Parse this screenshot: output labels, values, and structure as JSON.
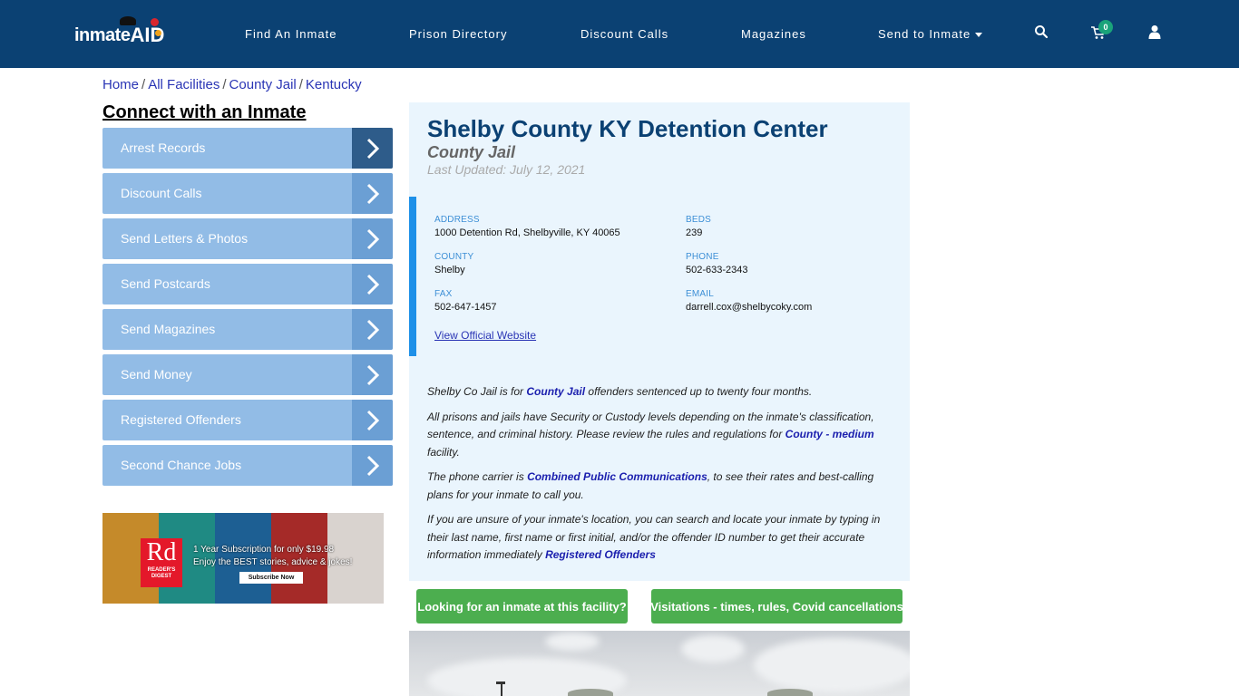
{
  "navbar": {
    "logo": {
      "prefix": "inmate",
      "suffix": "AID"
    },
    "items": [
      {
        "label": "Find An Inmate"
      },
      {
        "label": "Prison Directory"
      },
      {
        "label": "Discount Calls"
      },
      {
        "label": "Magazines"
      },
      {
        "label": "Send to Inmate",
        "has_dropdown": true
      }
    ],
    "icons": [
      "search-icon",
      "cart-icon",
      "user-icon"
    ],
    "cart_count": "0",
    "colors": {
      "background": "#0b4173",
      "badge": "#1aa37a"
    }
  },
  "breadcrumb": {
    "items": [
      "Home",
      "All Facilities",
      "County Jail",
      "Kentucky"
    ],
    "separator": "/"
  },
  "sidebar": {
    "title": "Connect with an Inmate",
    "items": [
      {
        "label": "Arrest Records",
        "active": true
      },
      {
        "label": "Discount Calls"
      },
      {
        "label": "Send Letters & Photos"
      },
      {
        "label": "Send Postcards"
      },
      {
        "label": "Send Magazines"
      },
      {
        "label": "Send Money"
      },
      {
        "label": "Registered Offenders"
      },
      {
        "label": "Second Chance Jobs"
      }
    ],
    "ad": {
      "logo_big": "Rd",
      "logo_small_1": "READER'S",
      "logo_small_2": "DIGEST",
      "line1": "1 Year Subscription for only $19.98",
      "line2": "Enjoy the BEST stories, advice & jokes!",
      "button": "Subscribe Now"
    }
  },
  "facility": {
    "name": "Shelby County KY Detention Center",
    "type": "County Jail",
    "last_updated": "Last Updated: July 12, 2021",
    "fields": {
      "address": {
        "label": "ADDRESS",
        "value": "1000 Detention Rd, Shelbyville, KY 40065"
      },
      "beds": {
        "label": "BEDS",
        "value": "239"
      },
      "county": {
        "label": "COUNTY",
        "value": "Shelby"
      },
      "phone": {
        "label": "PHONE",
        "value": "502-633-2343"
      },
      "fax": {
        "label": "FAX",
        "value": "502-647-1457"
      },
      "email": {
        "label": "EMAIL",
        "value": "darrell.cox@shelbycoky.com"
      }
    },
    "website_link": "View Official Website",
    "description": {
      "p1": {
        "before": "Shelby Co Jail is for ",
        "link": "County Jail",
        "after": " offenders sentenced up to twenty four months."
      },
      "p2": {
        "before": "All prisons and jails have Security or Custody levels depending on the inmate's classification, sentence, and criminal history. Please review the rules and regulations for ",
        "link": "County - medium",
        "after": " facility."
      },
      "p3": {
        "before": "The phone carrier is ",
        "link": "Combined Public Communications",
        "after": ", to see their rates and best-calling plans for your inmate to call you."
      },
      "p4": {
        "before": "If you are unsure of your inmate's location, you can search and locate your inmate by typing in their last name, first name or first initial, and/or the offender ID number to get their accurate information immediately ",
        "link": "Registered Offenders",
        "after": ""
      }
    }
  },
  "actions": {
    "find_inmate": "Looking for an inmate at this facility?",
    "visitations": "Visitations - times, rules, Covid cancellations"
  }
}
